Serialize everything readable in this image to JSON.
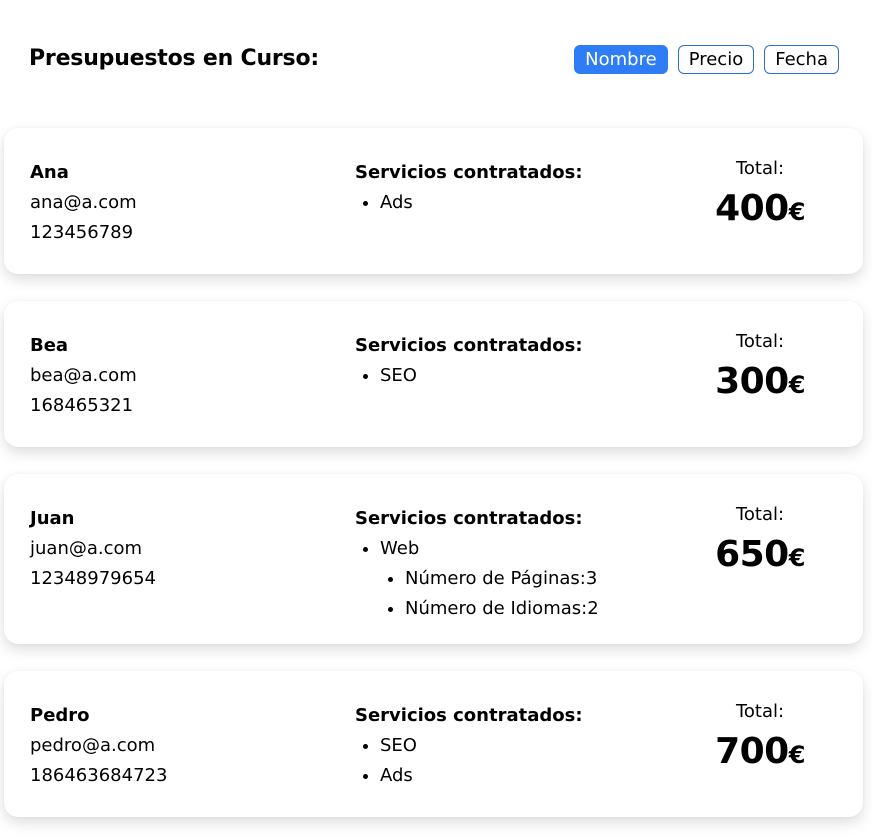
{
  "header": {
    "title": "Presupuestos en Curso:",
    "sort_buttons": [
      {
        "label": "Nombre",
        "active": true
      },
      {
        "label": "Precio",
        "active": false
      },
      {
        "label": "Fecha",
        "active": false
      }
    ]
  },
  "services_heading": "Servicios contratados:",
  "total_label": "Total:",
  "currency": "€",
  "budgets": [
    {
      "name": "Ana",
      "email": "ana@a.com",
      "phone": "123456789",
      "services": [
        "Ads"
      ],
      "total": "400"
    },
    {
      "name": "Bea",
      "email": "bea@a.com",
      "phone": "168465321",
      "services": [
        "SEO"
      ],
      "total": "300"
    },
    {
      "name": "Juan",
      "email": "juan@a.com",
      "phone": "12348979654",
      "services": [
        "Web"
      ],
      "web_details": [
        "Número de Páginas:3",
        "Número de Idiomas:2"
      ],
      "total": "650"
    },
    {
      "name": "Pedro",
      "email": "pedro@a.com",
      "phone": "186463684723",
      "services": [
        "SEO",
        "Ads"
      ],
      "total": "700"
    }
  ],
  "colors": {
    "accent": "#2f7df6",
    "accent_border": "#2f6fd0"
  }
}
